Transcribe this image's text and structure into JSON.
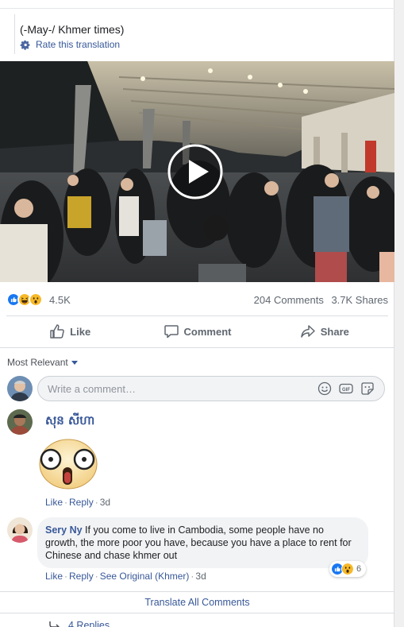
{
  "post": {
    "text": "(-May-/ Khmer times)",
    "rate_translation": "Rate this translation"
  },
  "video": {
    "play_icon": "play-icon"
  },
  "reactions": {
    "icons": [
      "like-icon",
      "haha-icon",
      "wow-icon"
    ],
    "count": "4.5K",
    "comments": "204 Comments",
    "shares": "3.7K Shares"
  },
  "actions": {
    "like": "Like",
    "comment": "Comment",
    "share": "Share"
  },
  "comments_filter": {
    "label": "Most Relevant"
  },
  "comment_box": {
    "placeholder": "Write a comment…",
    "icons": [
      "emoji-icon",
      "gif-icon",
      "sticker-icon"
    ]
  },
  "comments": [
    {
      "name": "សុន សីហា",
      "sticker": "shocked-face-sticker",
      "like": "Like",
      "reply": "Reply",
      "time": "3d"
    },
    {
      "name": "Sery Ny",
      "text": "If you come to live in Cambodia, some people have no growth, the more poor you have, because you have a place to rent for Chinese and chase khmer out",
      "like": "Like",
      "reply": "Reply",
      "see_original": "See Original (Khmer)",
      "time": "3d",
      "reaction_count": "6"
    }
  ],
  "translate_all": "Translate All Comments",
  "replies": "4 Replies",
  "colors": {
    "link": "#385898",
    "like_blue": "#1877f2",
    "meta_gray": "#606770",
    "bubble_bg": "#f2f3f5"
  }
}
